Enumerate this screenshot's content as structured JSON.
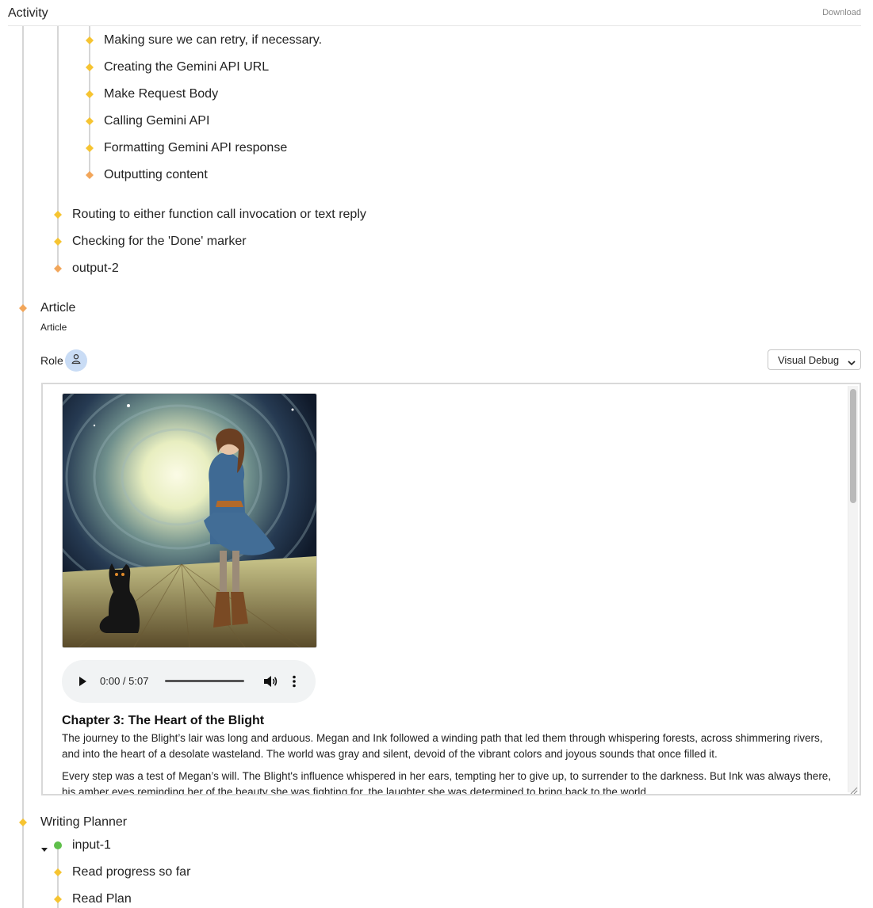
{
  "header": {
    "title": "Activity",
    "download_label": "Download"
  },
  "activity": {
    "nested_items": [
      {
        "label": "Making sure we can retry, if necessary.",
        "status": "yellow"
      },
      {
        "label": "Creating the Gemini API URL",
        "status": "yellow"
      },
      {
        "label": "Make Request Body",
        "status": "yellow"
      },
      {
        "label": "Calling Gemini API",
        "status": "yellow"
      },
      {
        "label": "Formatting Gemini API response",
        "status": "yellow"
      },
      {
        "label": "Outputting content",
        "status": "orange"
      }
    ],
    "mid_items": [
      {
        "label": "Routing to either function call invocation or text reply",
        "status": "yellow"
      },
      {
        "label": "Checking for the 'Done' marker",
        "status": "yellow"
      },
      {
        "label": "output-2",
        "status": "orange"
      }
    ],
    "article": {
      "title": "Article",
      "subtitle": "Article",
      "status": "orange",
      "role_label": "Role",
      "role_icon": "person-icon",
      "view_select": {
        "selected": "Visual Debug"
      },
      "audio": {
        "time": "0:00 / 5:07",
        "progress": 0
      },
      "image_alt": "Girl in blue dress with black cat in swirling tunnel",
      "chapter_title": "Chapter 3: The Heart of the Blight",
      "paragraphs": [
        "The journey to the Blight’s lair was long and arduous. Megan and Ink followed a winding path that led them through whispering forests, across shimmering rivers, and into the heart of a desolate wasteland. The world was gray and silent, devoid of the vibrant colors and joyous sounds that once filled it.",
        "Every step was a test of Megan’s will. The Blight's influence whispered in her ears, tempting her to give up, to surrender to the darkness. But Ink was always there, his amber eyes reminding her of the beauty she was fighting for, the laughter she was determined to bring back to the world."
      ]
    },
    "planner": {
      "title": "Writing Planner",
      "status": "yellow",
      "children": [
        {
          "label": "input-1",
          "status": "green",
          "expanded": true
        },
        {
          "label": "Read progress so far",
          "status": "yellow"
        },
        {
          "label": "Read Plan",
          "status": "yellow"
        }
      ]
    }
  },
  "colors": {
    "yellow": "#f6c431",
    "orange": "#f2a65a",
    "green": "#5fbf4a",
    "line": "#d6d6d6",
    "role_bg": "#c9dcf5"
  }
}
